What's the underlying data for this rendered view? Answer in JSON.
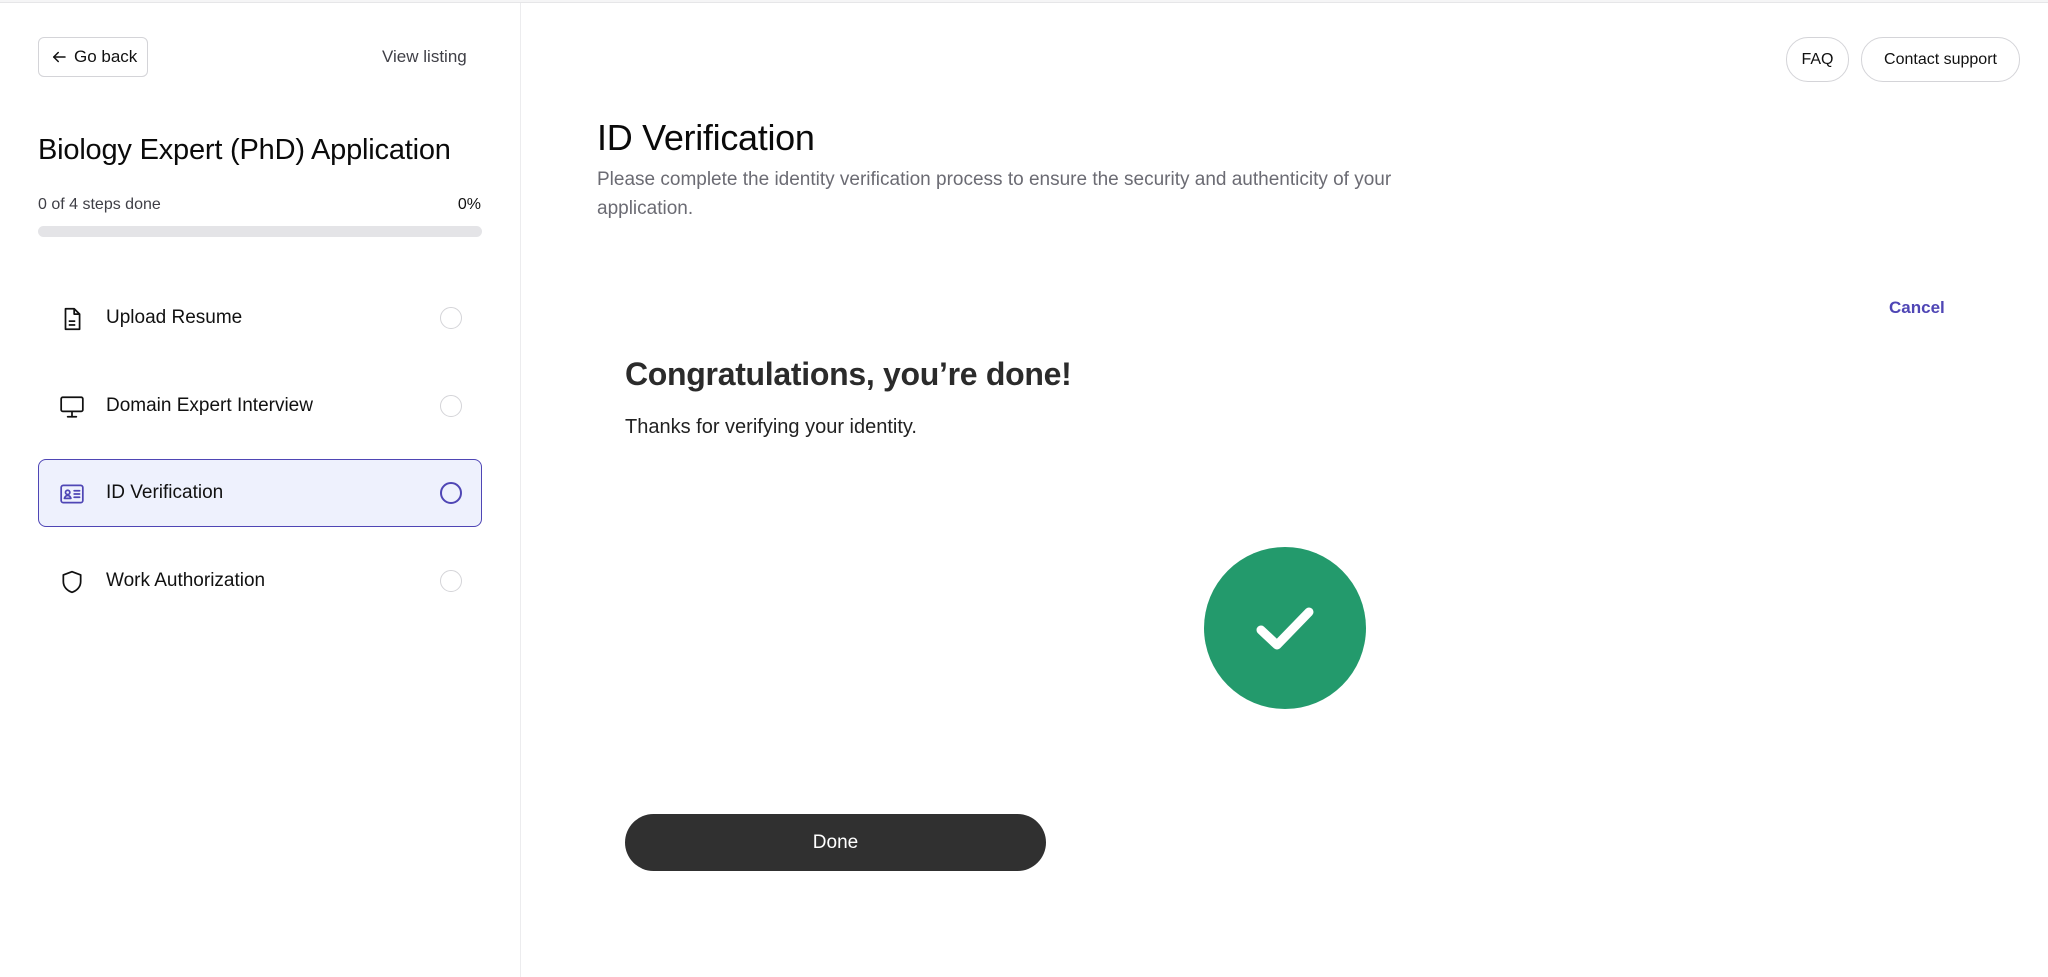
{
  "sidebar": {
    "go_back_label": "Go back",
    "view_listing_label": "View listing",
    "title": "Biology Expert (PhD) Application",
    "progress_text": "0 of 4 steps done",
    "progress_percent_text": "0%",
    "progress_fraction": 0,
    "steps": [
      {
        "label": "Upload Resume",
        "icon": "document-icon",
        "status": "incomplete",
        "active": false
      },
      {
        "label": "Domain Expert Interview",
        "icon": "monitor-icon",
        "status": "incomplete",
        "active": false
      },
      {
        "label": "ID Verification",
        "icon": "id-card-icon",
        "status": "incomplete",
        "active": true
      },
      {
        "label": "Work Authorization",
        "icon": "shield-icon",
        "status": "incomplete",
        "active": false
      }
    ]
  },
  "header": {
    "faq_label": "FAQ",
    "support_label": "Contact support"
  },
  "main": {
    "title": "ID Verification",
    "description": "Please complete the identity verification process to ensure the security and authenticity of your application.",
    "cancel_label": "Cancel",
    "success_heading": "Congratulations, you’re done!",
    "success_message": "Thanks for verifying your identity.",
    "success_icon": "checkmark-icon",
    "done_label": "Done"
  },
  "colors": {
    "accent": "#4f46b5",
    "active_bg": "#eef1fd",
    "success": "#239a6c",
    "done_button": "#303030"
  }
}
